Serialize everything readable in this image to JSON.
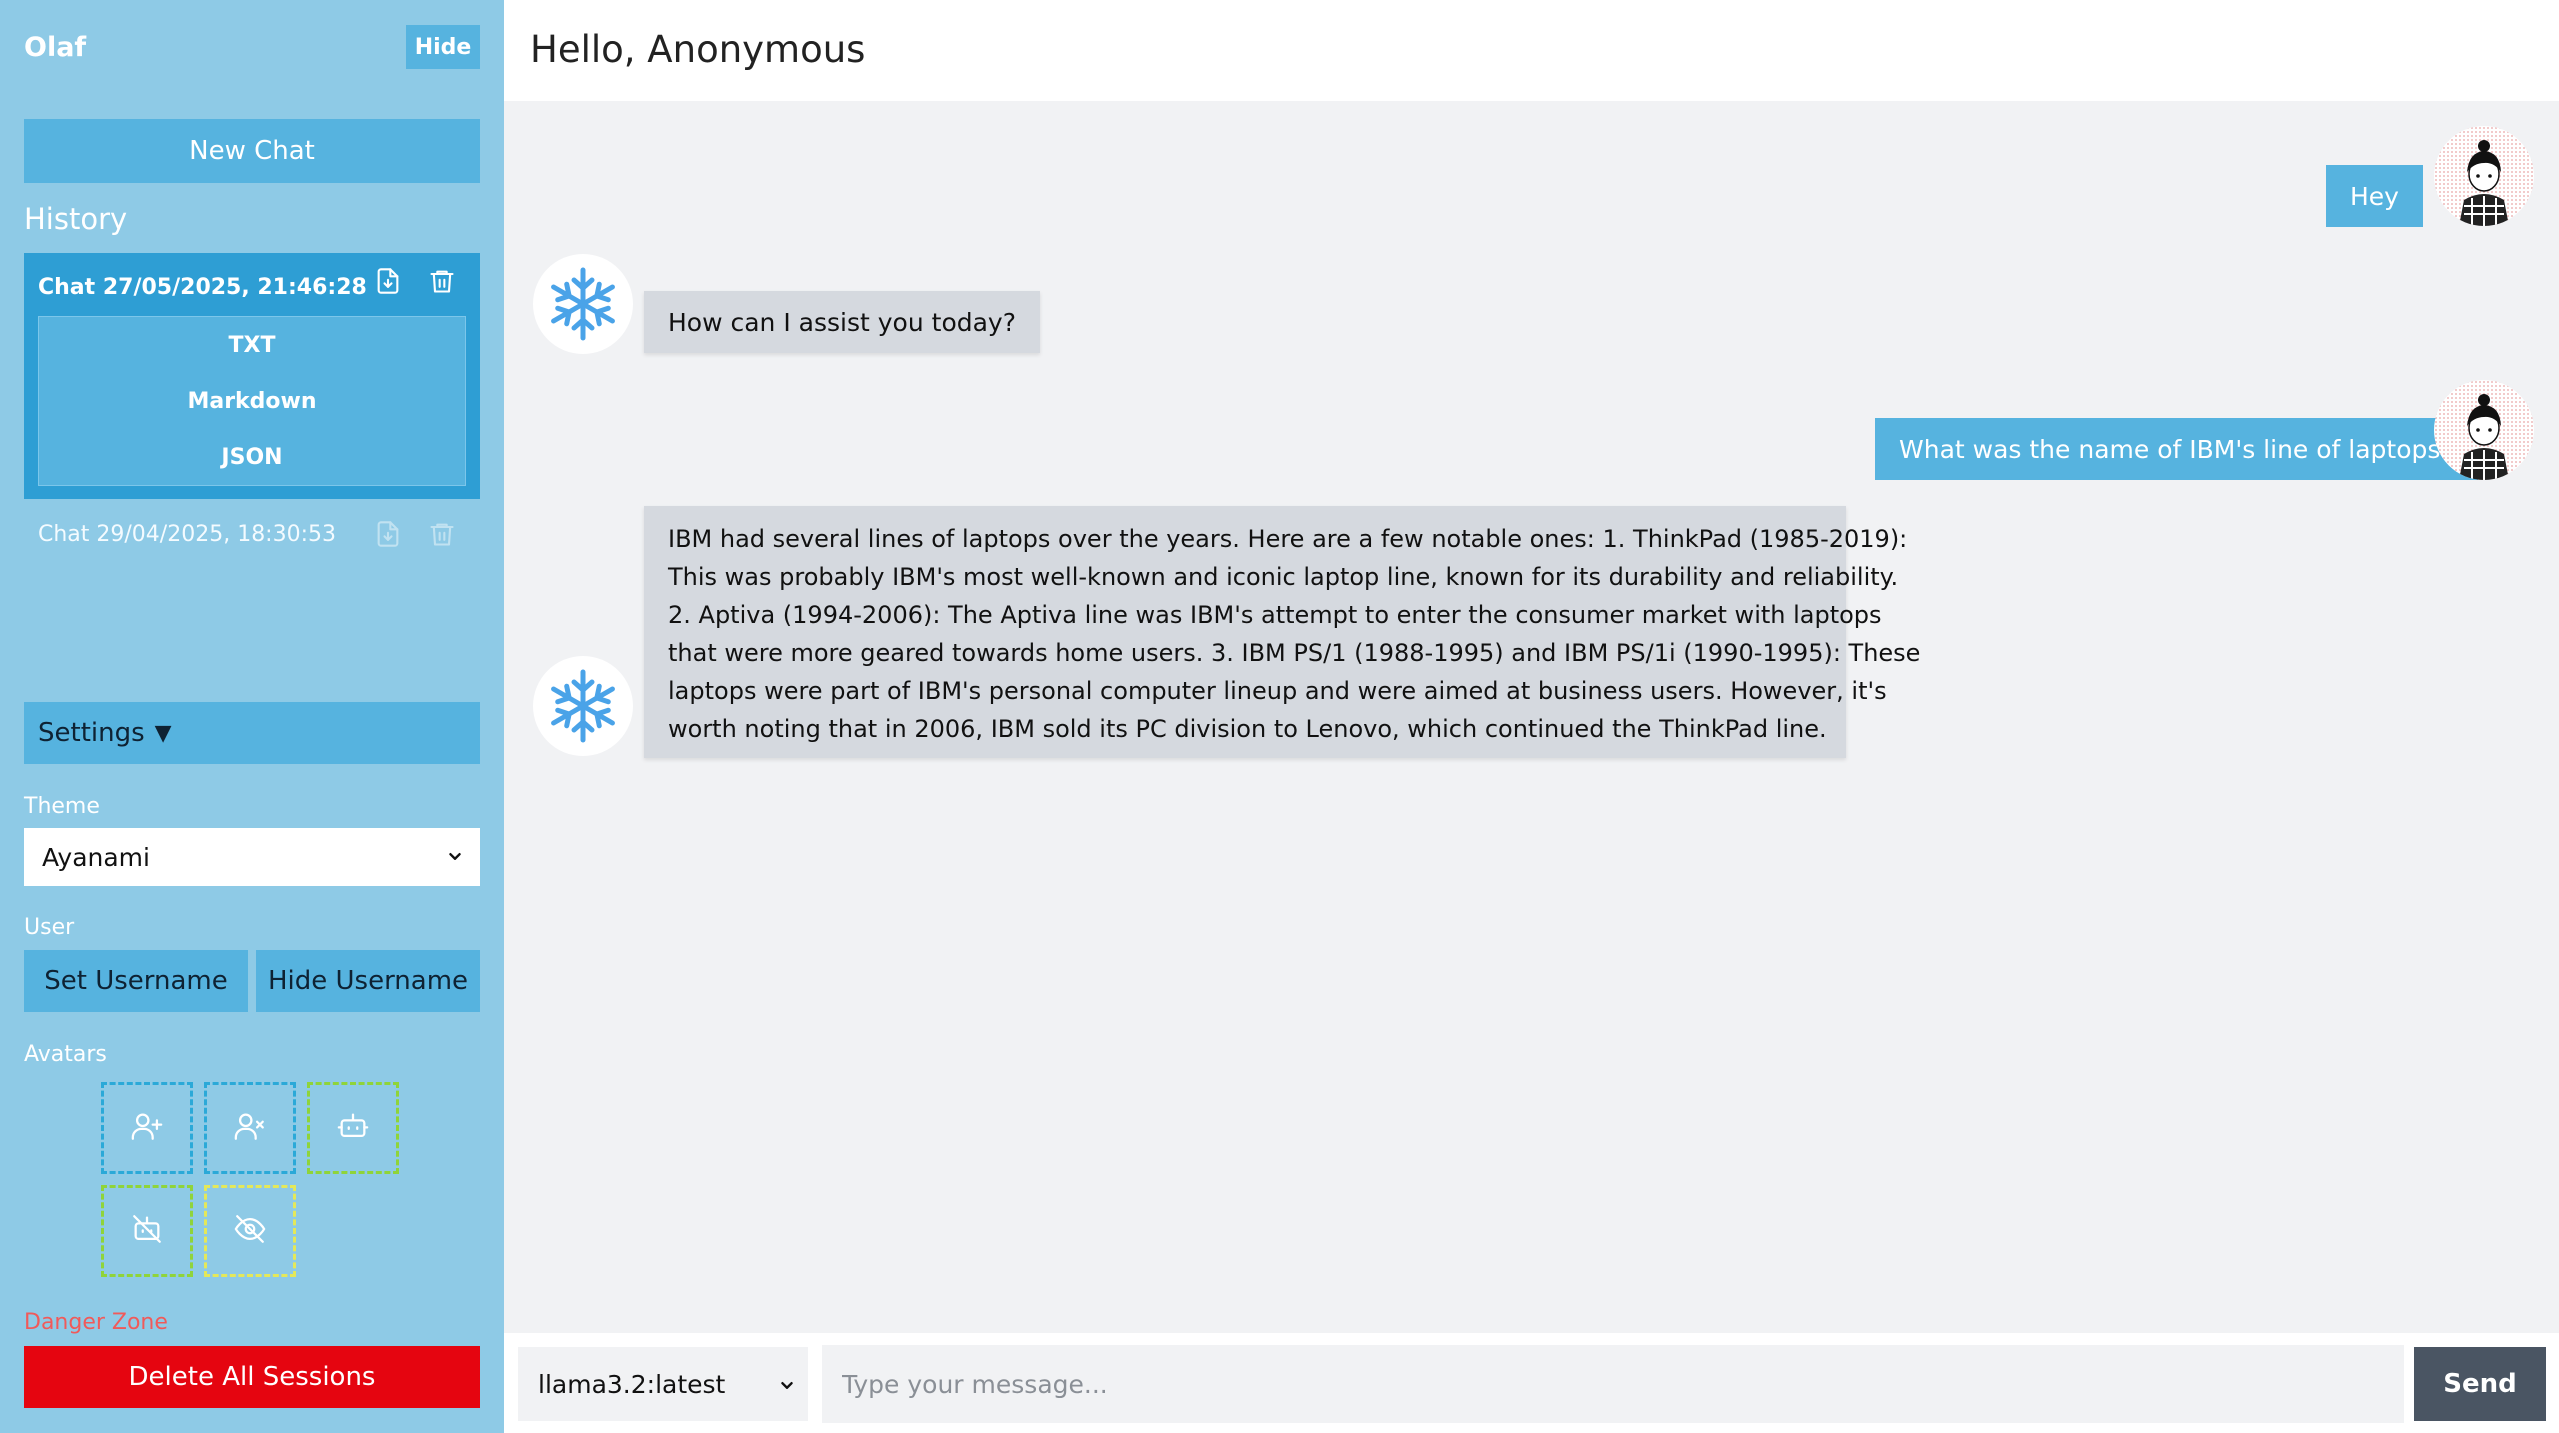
{
  "sidebar": {
    "app_title": "Olaf",
    "hide_label": "Hide",
    "new_chat_label": "New Chat",
    "history_title": "History",
    "sessions": [
      {
        "title": "Chat 27/05/2025, 21:46:28",
        "active": true
      },
      {
        "title": "Chat 29/04/2025, 18:30:53",
        "active": false
      }
    ],
    "export_options": [
      "TXT",
      "Markdown",
      "JSON"
    ],
    "settings_label": "Settings",
    "theme_label": "Theme",
    "theme_value": "Ayanami",
    "user_label": "User",
    "set_username_label": "Set Username",
    "hide_username_label": "Hide Username",
    "avatars_label": "Avatars",
    "avatar_actions": [
      "user-plus-icon",
      "user-x-icon",
      "bot-icon",
      "camera-off-icon",
      "eye-off-icon"
    ],
    "danger_label": "Danger Zone",
    "delete_all_label": "Delete All Sessions"
  },
  "header": {
    "greeting": "Hello, Anonymous"
  },
  "messages": [
    {
      "role": "user",
      "text": "Hey"
    },
    {
      "role": "assistant",
      "text": "How can I assist you today?"
    },
    {
      "role": "user",
      "text": "What was the name of IBM's line of laptops?"
    },
    {
      "role": "assistant",
      "lines": [
        "IBM had several lines of laptops over the years. Here are a few notable ones: 1. ThinkPad (1985-2019):",
        "This was probably IBM's most well-known and iconic laptop line, known for its durability and reliability.",
        "2. Aptiva (1994-2006): The Aptiva line was IBM's attempt to enter the consumer market with laptops",
        "that were more geared towards home users. 3. IBM PS/1 (1988-1995) and IBM PS/1i (1990-1995): These",
        "laptops were part of IBM's personal computer lineup and were aimed at business users. However, it's",
        "worth noting that in 2006, IBM sold its PC division to Lenovo, which continued the ThinkPad line."
      ]
    }
  ],
  "input": {
    "model_value": "llama3.2:latest",
    "placeholder": "Type your message...",
    "send_label": "Send"
  },
  "colors": {
    "sidebar_bg": "#8ecae6",
    "accent": "#56b3df",
    "active_session": "#2e9ed4",
    "danger": "#e50510",
    "send": "#4a5563"
  }
}
